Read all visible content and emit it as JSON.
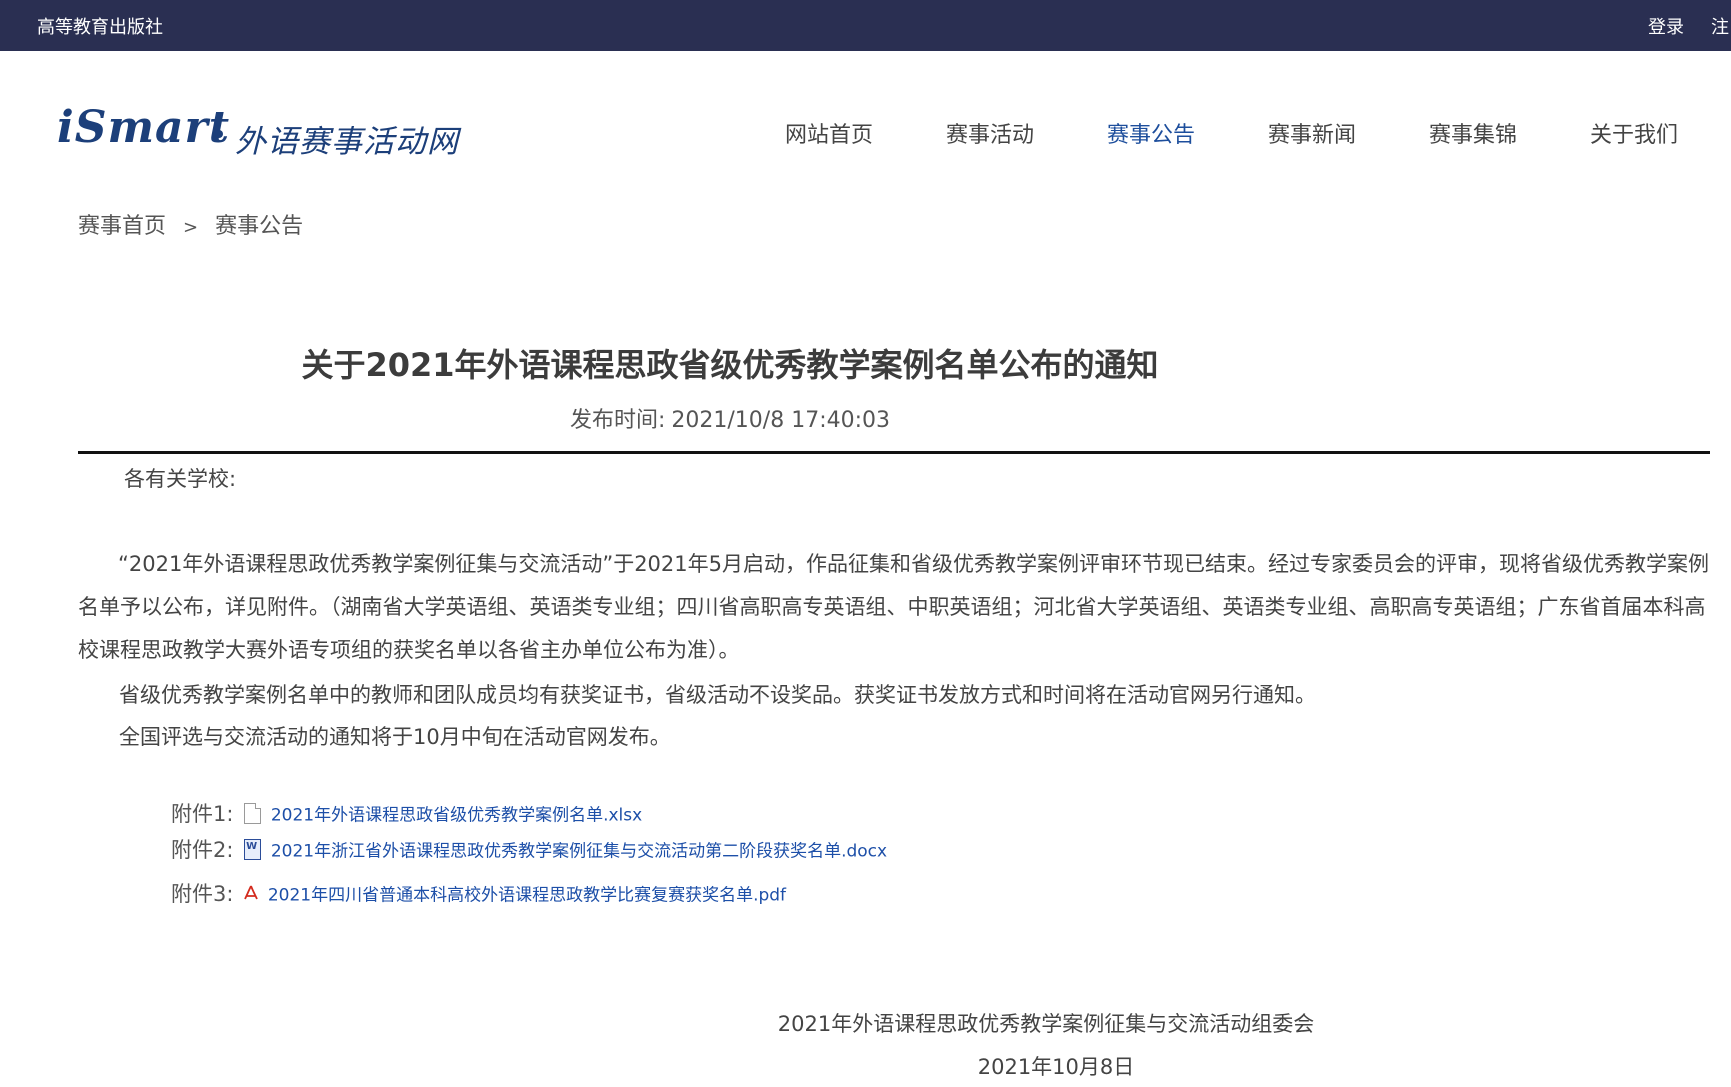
{
  "topbar": {
    "publisher": "高等教育出版社",
    "login": "登录",
    "register": "注"
  },
  "logo": {
    "brand": "iSmart",
    "subtitle": "外语赛事活动网"
  },
  "nav": {
    "items": [
      "网站首页",
      "赛事活动",
      "赛事公告",
      "赛事新闻",
      "赛事集锦",
      "关于我们"
    ],
    "active": "赛事公告"
  },
  "breadcrumb": {
    "home": "赛事首页",
    "separator": ">",
    "current": "赛事公告"
  },
  "article": {
    "title": "关于2021年外语课程思政省级优秀教学案例名单公布的通知",
    "time_label": "发布时间:",
    "time_value": "2021/10/8 17:40:03",
    "greeting": "各有关学校:",
    "paragraph1": "“2021年外语课程思政优秀教学案例征集与交流活动”于2021年5月启动，作品征集和省级优秀教学案例评审环节现已结束。经过专家委员会的评审，现将省级优秀教学案例名单予以公布，详见附件。（湖南省大学英语组、英语类专业组；四川省高职高专英语组、中职英语组；河北省大学英语组、英语类专业组、高职高专英语组；广东省首届本科高校课程思政教学大赛外语专项组的获奖名单以各省主办单位公布为准）。",
    "paragraph2": "省级优秀教学案例名单中的教师和团队成员均有获奖证书，省级活动不设奖品。获奖证书发放方式和时间将在活动官网另行通知。",
    "paragraph3": "全国评选与交流活动的通知将于10月中旬在活动官网发布。",
    "attachments": [
      {
        "label": "附件1:",
        "type": "xlsx",
        "name": "2021年外语课程思政省级优秀教学案例名单.xlsx"
      },
      {
        "label": "附件2:",
        "type": "docx",
        "name": "2021年浙江省外语课程思政优秀教学案例征集与交流活动第二阶段获奖名单.docx"
      },
      {
        "label": "附件3:",
        "type": "pdf",
        "name": "2021年四川省普通本科高校外语课程思政教学比赛复赛获奖名单.pdf"
      }
    ],
    "signature": "2021年外语课程思政优秀教学案例征集与交流活动组委会",
    "date": "2021年10月8日"
  },
  "colors": {
    "topbar_bg": "#2a2f52",
    "nav_active": "#1d4e9c",
    "link": "#1d4fa8",
    "logo": "#1c3f7a"
  },
  "icons": [
    "xlsx-file-icon",
    "docx-file-icon",
    "pdf-file-icon"
  ]
}
